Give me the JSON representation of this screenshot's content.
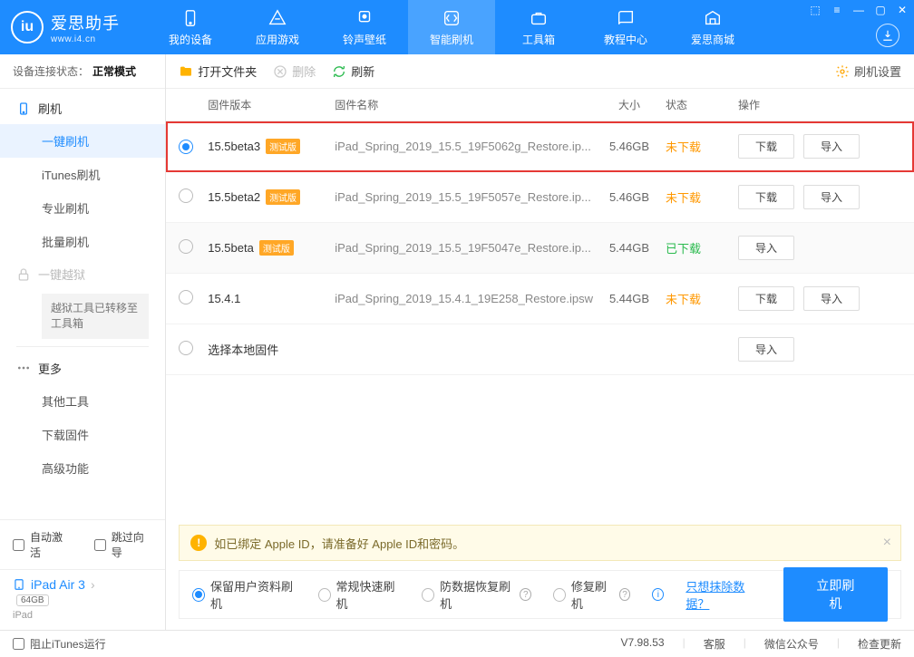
{
  "app": {
    "name": "爱思助手",
    "url": "www.i4.cn"
  },
  "nav": [
    {
      "label": "我的设备"
    },
    {
      "label": "应用游戏"
    },
    {
      "label": "铃声壁纸"
    },
    {
      "label": "智能刷机"
    },
    {
      "label": "工具箱"
    },
    {
      "label": "教程中心"
    },
    {
      "label": "爱思商城"
    }
  ],
  "conn": {
    "label": "设备连接状态：",
    "value": "正常模式"
  },
  "sidebar": {
    "flash": "刷机",
    "items": [
      "一键刷机",
      "iTunes刷机",
      "专业刷机",
      "批量刷机"
    ],
    "jailbreak": "一键越狱",
    "jb_note": "越狱工具已转移至工具箱",
    "more": "更多",
    "more_items": [
      "其他工具",
      "下载固件",
      "高级功能"
    ]
  },
  "auto": {
    "activate": "自动激活",
    "skip": "跳过向导"
  },
  "device": {
    "name": "iPad Air 3",
    "capacity": "64GB",
    "type": "iPad"
  },
  "toolbar": {
    "open": "打开文件夹",
    "delete": "删除",
    "refresh": "刷新",
    "settings": "刷机设置"
  },
  "thead": {
    "ver": "固件版本",
    "name": "固件名称",
    "size": "大小",
    "status": "状态",
    "ops": "操作"
  },
  "badge": "测试版",
  "btns": {
    "download": "下载",
    "import": "导入"
  },
  "rows": [
    {
      "ver": "15.5beta3",
      "beta": true,
      "name": "iPad_Spring_2019_15.5_19F5062g_Restore.ip...",
      "size": "5.46GB",
      "status": "未下载",
      "status_cls": "not",
      "selected": true,
      "dl": true,
      "hl": true
    },
    {
      "ver": "15.5beta2",
      "beta": true,
      "name": "iPad_Spring_2019_15.5_19F5057e_Restore.ip...",
      "size": "5.46GB",
      "status": "未下载",
      "status_cls": "not",
      "dl": true
    },
    {
      "ver": "15.5beta",
      "beta": true,
      "name": "iPad_Spring_2019_15.5_19F5047e_Restore.ip...",
      "size": "5.44GB",
      "status": "已下载",
      "status_cls": "done",
      "dl": false,
      "alt": true
    },
    {
      "ver": "15.4.1",
      "beta": false,
      "name": "iPad_Spring_2019_15.4.1_19E258_Restore.ipsw",
      "size": "5.44GB",
      "status": "未下载",
      "status_cls": "not",
      "dl": true
    }
  ],
  "local_row": "选择本地固件",
  "hint": "如已绑定 Apple ID，请准备好 Apple ID和密码。",
  "options": {
    "keep": "保留用户资料刷机",
    "normal": "常规快速刷机",
    "antidel": "防数据恢复刷机",
    "repair": "修复刷机",
    "erase_link": "只想抹除数据？",
    "flash": "立即刷机"
  },
  "statusbar": {
    "block": "阻止iTunes运行",
    "version": "V7.98.53",
    "items": [
      "客服",
      "微信公众号",
      "检查更新"
    ]
  }
}
